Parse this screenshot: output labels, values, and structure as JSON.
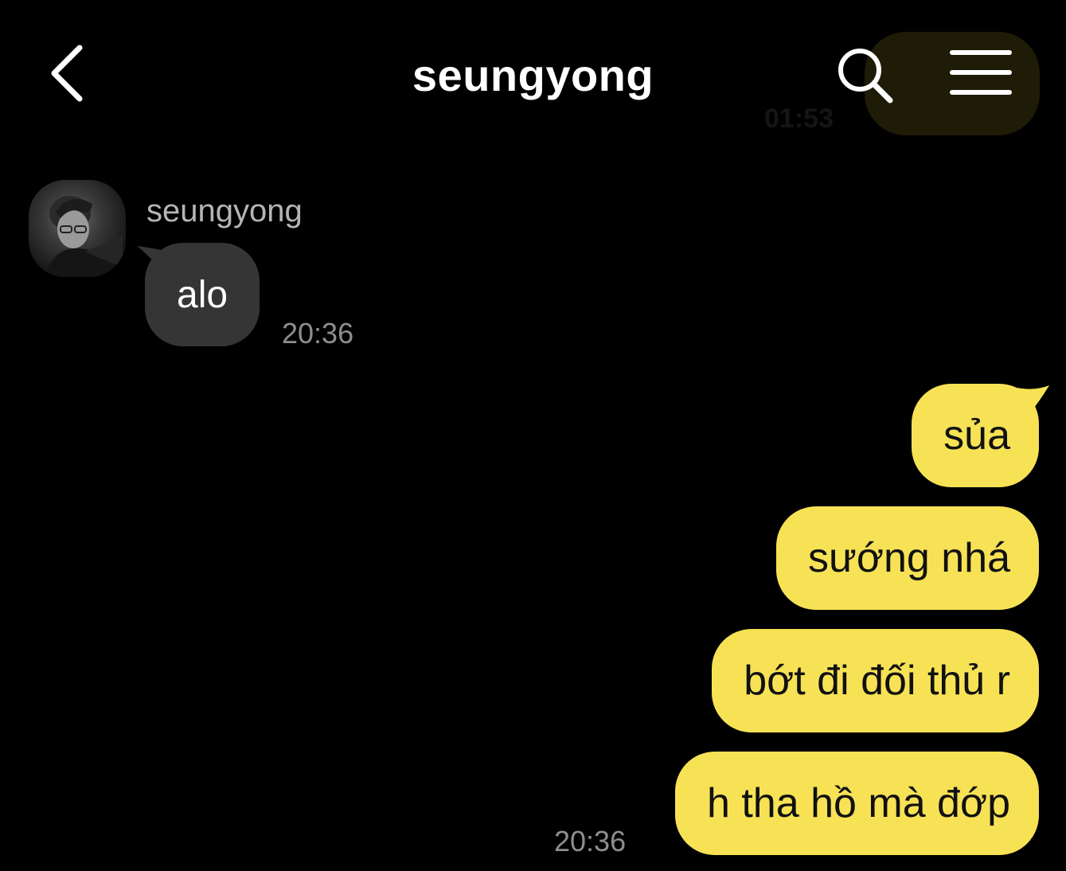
{
  "header": {
    "title": "seungyong",
    "back_icon": "chevron-left-icon",
    "search_icon": "search-icon",
    "menu_icon": "menu-icon"
  },
  "ghost": {
    "time": "01:53"
  },
  "incoming": {
    "sender": "seungyong",
    "messages": [
      "alo"
    ],
    "time": "20:36"
  },
  "outgoing": {
    "messages": [
      "sủa",
      "sướng nhá",
      "bớt đi đối thủ r",
      "h tha hồ mà đớp"
    ],
    "time": "20:36"
  },
  "colors": {
    "background": "#000000",
    "incoming_bubble": "#353535",
    "outgoing_bubble": "#f7e255"
  }
}
